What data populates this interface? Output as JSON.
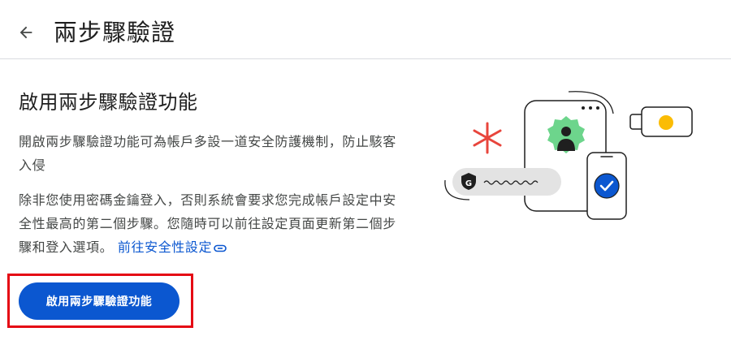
{
  "header": {
    "back_icon": "arrow-left-icon",
    "title": "兩步驟驗證"
  },
  "main": {
    "heading": "啟用兩步驟驗證功能",
    "paragraph1": "開啟兩步驟驗證功能可為帳戶多設一道安全防護機制，防止駭客入侵",
    "paragraph2": "除非您使用密碼金鑰登入，否則系統會要求您完成帳戶設定中安全性最高的第二個步驟。您隨時可以前往設定頁面更新第二個步驟和登入選項。",
    "security_link": "前往安全性設定",
    "link_icon": "link-icon",
    "enable_button": "啟用兩步驟驗證功能"
  },
  "illustration": {
    "icons": [
      "asterisk-icon",
      "phone-icon",
      "avatar-icon",
      "security-key-icon",
      "google-g-icon",
      "checkmark-icon"
    ],
    "colors": {
      "asterisk": "#e8453c",
      "avatar_badge": "#6dd58c",
      "key_light": "#fbbc04",
      "check_circle": "#0b57d0",
      "pill": "#e3e3e3"
    }
  },
  "colors": {
    "primary": "#0b57d0",
    "highlight_border": "#e50914",
    "divider": "#dadce0",
    "text_primary": "#1f1f1f",
    "text_secondary": "#444746"
  }
}
